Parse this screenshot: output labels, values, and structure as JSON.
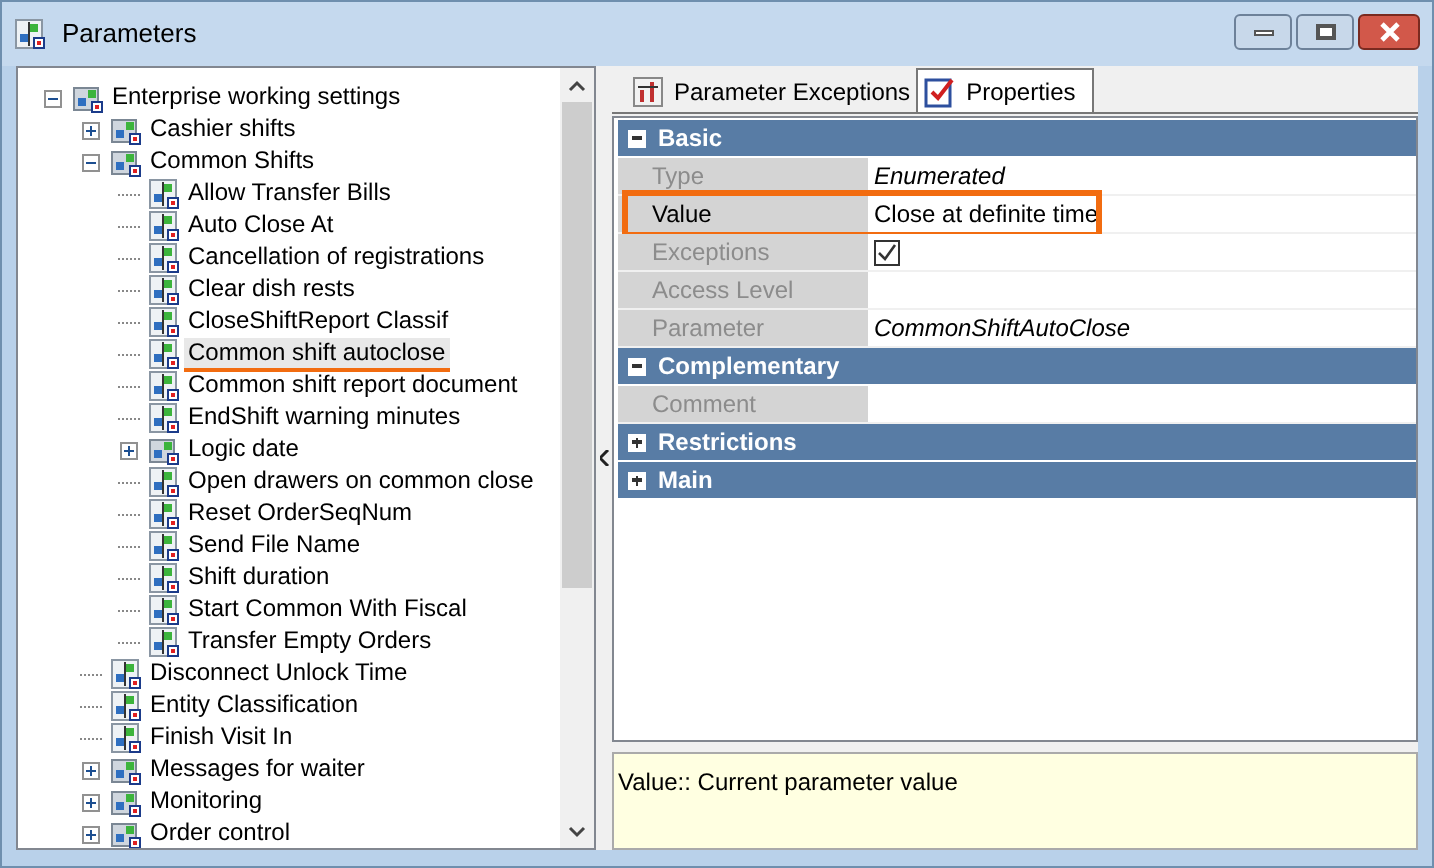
{
  "window": {
    "title": "Parameters"
  },
  "tree": [
    {
      "label": "Enterprise working settings",
      "kind": "group",
      "expanded": true,
      "selected": false,
      "marked": false,
      "children": [
        {
          "label": "Cashier shifts",
          "kind": "group",
          "expanded": false,
          "selected": false,
          "marked": false
        },
        {
          "label": "Common Shifts",
          "kind": "group",
          "expanded": true,
          "selected": false,
          "marked": false,
          "children": [
            {
              "label": "Allow Transfer Bills",
              "kind": "param",
              "selected": false,
              "marked": false
            },
            {
              "label": "Auto Close At",
              "kind": "param",
              "selected": false,
              "marked": false
            },
            {
              "label": "Cancellation of registrations",
              "kind": "param",
              "selected": false,
              "marked": false
            },
            {
              "label": "Clear dish rests",
              "kind": "param",
              "selected": false,
              "marked": false
            },
            {
              "label": "CloseShiftReport Classif",
              "kind": "param",
              "selected": false,
              "marked": false
            },
            {
              "label": "Common shift autoclose",
              "kind": "param",
              "selected": true,
              "marked": true
            },
            {
              "label": "Common shift report document",
              "kind": "param",
              "selected": false,
              "marked": false
            },
            {
              "label": "EndShift warning minutes",
              "kind": "param",
              "selected": false,
              "marked": false
            },
            {
              "label": "Logic date",
              "kind": "group",
              "expanded": false,
              "selected": false,
              "marked": false
            },
            {
              "label": "Open drawers on common close",
              "kind": "param",
              "selected": false,
              "marked": false
            },
            {
              "label": "Reset OrderSeqNum",
              "kind": "param",
              "selected": false,
              "marked": false
            },
            {
              "label": "Send File Name",
              "kind": "param",
              "selected": false,
              "marked": false
            },
            {
              "label": "Shift duration",
              "kind": "param",
              "selected": false,
              "marked": false
            },
            {
              "label": "Start Common With Fiscal",
              "kind": "param",
              "selected": false,
              "marked": false
            },
            {
              "label": "Transfer Empty Orders",
              "kind": "param",
              "selected": false,
              "marked": false
            }
          ]
        },
        {
          "label": "Disconnect Unlock Time",
          "kind": "param",
          "selected": false,
          "marked": false
        },
        {
          "label": "Entity Classification",
          "kind": "param",
          "selected": false,
          "marked": false
        },
        {
          "label": "Finish Visit In",
          "kind": "param",
          "selected": false,
          "marked": false
        },
        {
          "label": "Messages for waiter",
          "kind": "group",
          "expanded": false,
          "selected": false,
          "marked": false
        },
        {
          "label": "Monitoring",
          "kind": "group",
          "expanded": false,
          "selected": false,
          "marked": false
        },
        {
          "label": "Order control",
          "kind": "group",
          "expanded": false,
          "selected": false,
          "marked": false
        }
      ]
    }
  ],
  "tabs": [
    {
      "label": "Parameter Exceptions",
      "selected": false
    },
    {
      "label": "Properties",
      "selected": true
    }
  ],
  "categories": [
    {
      "title": "Basic",
      "expanded": true,
      "rows": [
        {
          "label": "Type",
          "kind": "text",
          "value": "Enumerated",
          "italic": true,
          "marked": false
        },
        {
          "label": "Value",
          "kind": "text",
          "value": "Close at definite time",
          "italic": false,
          "marked": true
        },
        {
          "label": "Exceptions",
          "kind": "checkbox",
          "checked": true,
          "marked": false
        },
        {
          "label": "Access Level",
          "kind": "empty",
          "marked": false
        },
        {
          "label": "Parameter",
          "kind": "text",
          "value": "CommonShiftAutoClose",
          "italic": true,
          "marked": false
        }
      ]
    },
    {
      "title": "Complementary",
      "expanded": true,
      "rows": [
        {
          "label": "Comment",
          "kind": "empty",
          "marked": false
        }
      ]
    },
    {
      "title": "Restrictions",
      "expanded": false
    },
    {
      "title": "Main",
      "expanded": false
    }
  ],
  "description": "Value:: Current parameter value"
}
